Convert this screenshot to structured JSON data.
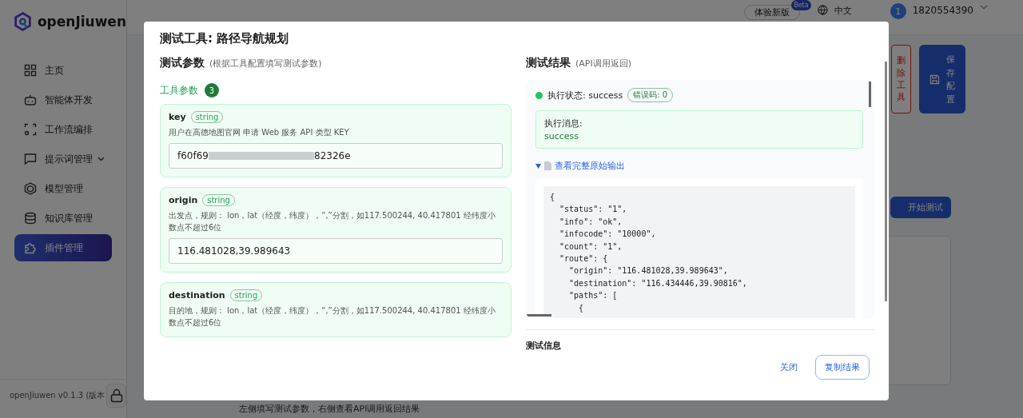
{
  "app": {
    "logo_text": "openJiuwen",
    "version": "openJiuwen v0.1.3 (版本"
  },
  "sidebar": {
    "items": [
      {
        "label": "主页",
        "selected": false,
        "has_submenu": false
      },
      {
        "label": "智能体开发",
        "selected": false,
        "has_submenu": false
      },
      {
        "label": "工作流编排",
        "selected": false,
        "has_submenu": false
      },
      {
        "label": "提示词管理",
        "selected": false,
        "has_submenu": true
      },
      {
        "label": "模型管理",
        "selected": false,
        "has_submenu": false
      },
      {
        "label": "知识库管理",
        "selected": false,
        "has_submenu": false
      },
      {
        "label": "插件管理",
        "selected": true,
        "has_submenu": false
      }
    ]
  },
  "header": {
    "new_version": "体验新版",
    "beta": "Beta",
    "language": "中文",
    "avatar": "1",
    "user": "1820554390"
  },
  "page": {
    "delete_button": "删除工具",
    "save_button": "保存配置",
    "start_button": "开始测试",
    "hint": "左侧填写测试参数，右侧查看API调用返回结果"
  },
  "dialog": {
    "title": "测试工具: 路径导航规划",
    "params": {
      "heading": "测试参数",
      "note": "(根据工具配置填写测试参数)",
      "group": "工具参数",
      "count": "3",
      "items": [
        {
          "name": "key",
          "type": "string",
          "description": "用户在高德地图官网 申请 Web 服务 API 类型 KEY",
          "value_prefix": "f60f69",
          "value_suffix": "82326e",
          "redacted": true
        },
        {
          "name": "origin",
          "type": "string",
          "description": "出发点，规则： lon，lat（经度，纬度），“,”分割，如117.500244, 40.417801 经纬度小数点不超过6位",
          "value_prefix": "116.481028,39.989643"
        },
        {
          "name": "destination",
          "type": "string",
          "description": "目的地，规则： lon，lat（经度，纬度），“,”分割，如117.500244, 40.417801 经纬度小数点不超过6位"
        }
      ]
    },
    "result": {
      "heading": "测试结果",
      "note": "(API调用返回)",
      "status": "执行状态: success",
      "status_ok": true,
      "error_code": "错误码: 0",
      "message_label": "执行消息:",
      "message": "success",
      "raw_toggle": "查看完整原始输出",
      "expanded": true,
      "raw_lines": [
        "{",
        "  \"status\": \"1\",",
        "  \"info\": \"ok\",",
        "  \"infocode\": \"10000\",",
        "  \"count\": \"1\",",
        "  \"route\": {",
        "    \"origin\": \"116.481028,39.989643\",",
        "    \"destination\": \"116.434446,39.90816\",",
        "    \"paths\": [",
        "      {"
      ]
    },
    "info_heading": "测试信息",
    "buttons": {
      "close": "关闭",
      "copy": "复制结果"
    }
  }
}
